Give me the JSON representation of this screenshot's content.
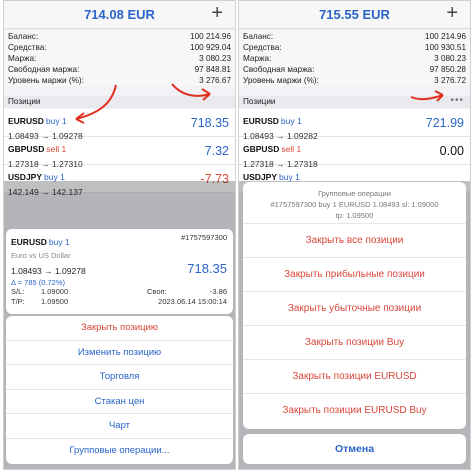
{
  "left": {
    "balance_title": "714.08 EUR",
    "summary": [
      {
        "label": "Баланс:",
        "value": "100 214.96"
      },
      {
        "label": "Средства:",
        "value": "100 929.04"
      },
      {
        "label": "Маржа:",
        "value": "3 080.23"
      },
      {
        "label": "Свободная маржа:",
        "value": "97 848.81"
      },
      {
        "label": "Уровень маржи (%):",
        "value": "3 276.67"
      }
    ],
    "section_label": "Позиции",
    "positions": [
      {
        "symbol": "EURUSD",
        "dir": "buy 1",
        "prices": "1.08493 → 1.09278",
        "profit": "718.35"
      },
      {
        "symbol": "GBPUSD",
        "dir": "sell 1",
        "prices": "1.27318 → 1.27310",
        "profit": "7.32"
      },
      {
        "symbol": "USDJPY",
        "dir": "buy 1",
        "prices": "142.149 → 142.137",
        "profit": "-7.73"
      }
    ],
    "detail": {
      "symbol": "EURUSD",
      "dir": "buy 1",
      "ticket": "#1757597300",
      "desc": "Euro vs US Dollar",
      "prices": "1.08493 → 1.09278",
      "delta": "Δ = 785 (0.72%)",
      "profit": "718.35",
      "sl_label": "S/L:",
      "sl_value": "1.09000",
      "swap_label": "Своп:",
      "swap_value": "-3.86",
      "tp_label": "T/P:",
      "tp_value": "1.09500",
      "date": "2023.06.14 15:00:14"
    },
    "actions": [
      "Закрыть позицию",
      "Изменить позицию",
      "Торговля",
      "Стакан цен",
      "Чарт",
      "Групповые операции..."
    ]
  },
  "right": {
    "balance_title": "715.55 EUR",
    "summary": [
      {
        "label": "Баланс:",
        "value": "100 214.96"
      },
      {
        "label": "Средства:",
        "value": "100 930.51"
      },
      {
        "label": "Маржа:",
        "value": "3 080.23"
      },
      {
        "label": "Свободная маржа:",
        "value": "97 850.28"
      },
      {
        "label": "Уровень маржи (%):",
        "value": "3 276.72"
      }
    ],
    "section_label": "Позиции",
    "positions": [
      {
        "symbol": "EURUSD",
        "dir": "buy 1",
        "prices": "1.08493 → 1.09282",
        "profit": "721.99"
      },
      {
        "symbol": "GBPUSD",
        "dir": "sell 1",
        "prices": "1.27318 → 1.27318",
        "profit": "0.00"
      },
      {
        "symbol": "USDJPY",
        "dir": "buy 1",
        "prices": "",
        "profit": ""
      }
    ],
    "group_sheet": {
      "title": "Групповые операции",
      "subtitle": "#1757597300 buy 1 EURUSD 1.08493 sl: 1.09000",
      "subtitle2": "tp: 1.09500",
      "items": [
        "Закрыть все позиции",
        "Закрыть прибыльные позиции",
        "Закрыть убыточные позиции",
        "Закрыть позиции Buy",
        "Закрыть позиции EURUSD",
        "Закрыть позиции EURUSD Buy"
      ],
      "cancel": "Отмена"
    }
  },
  "plus_icon": "plus-icon",
  "dots_icon": "more-dots-icon"
}
